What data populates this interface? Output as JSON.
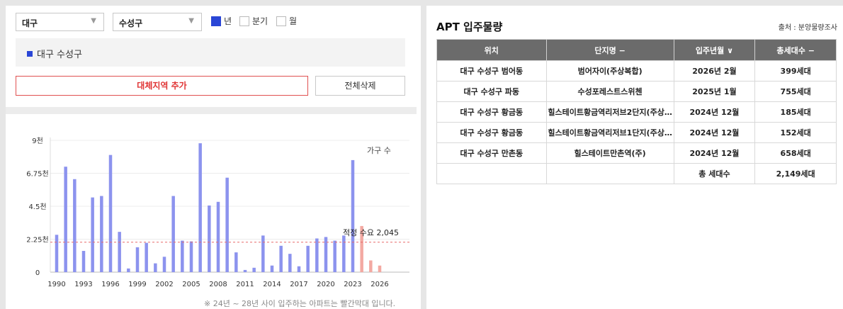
{
  "filters": {
    "region": "대구",
    "district": "수성구",
    "period_options": [
      {
        "label": "년",
        "checked": true
      },
      {
        "label": "분기",
        "checked": false
      },
      {
        "label": "월",
        "checked": false
      }
    ]
  },
  "selected_regions": [
    "대구 수성구"
  ],
  "buttons": {
    "add_region": "대체지역 추가",
    "clear_all": "전체삭제"
  },
  "colors": {
    "accent": "#2a46d6",
    "bar_past": "#8c93ee",
    "bar_future": "#f3a9a2",
    "threshold": "#e86a6a"
  },
  "chart_data": {
    "type": "bar",
    "unit_label": "가구 수",
    "x": [
      1990,
      1991,
      1992,
      1993,
      1994,
      1995,
      1996,
      1997,
      1998,
      1999,
      2000,
      2001,
      2002,
      2003,
      2004,
      2005,
      2006,
      2007,
      2008,
      2009,
      2010,
      2011,
      2012,
      2013,
      2014,
      2015,
      2016,
      2017,
      2018,
      2019,
      2020,
      2021,
      2022,
      2023,
      2024,
      2025,
      2026
    ],
    "values": [
      2550,
      7200,
      6350,
      1450,
      5100,
      5200,
      8000,
      2750,
      250,
      1700,
      2000,
      600,
      1050,
      5200,
      2150,
      2100,
      8800,
      4550,
      4800,
      6450,
      1350,
      150,
      300,
      2500,
      450,
      1800,
      1250,
      400,
      1800,
      2300,
      2400,
      2150,
      2500,
      7650,
      3150,
      800,
      450
    ],
    "future_from": 2024,
    "x_ticks": [
      "1990",
      "1993",
      "1996",
      "1999",
      "2002",
      "2005",
      "2008",
      "2011",
      "2014",
      "2017",
      "2020",
      "2023",
      "2026"
    ],
    "y_ticks": [
      "0",
      "2.25천",
      "4.5천",
      "6.75천",
      "9천"
    ],
    "ylim": [
      0,
      9000
    ],
    "threshold": {
      "label": "적정 수요 2,045",
      "value": 2045
    },
    "footnote": "※ 24년 ~ 28년 사이 입주하는 아파트는 빨간막대 입니다."
  },
  "apt": {
    "title": "APT 입주물량",
    "source": "출처 : 분양물량조사",
    "headers": [
      "위치",
      "단지명 −",
      "입주년월 ∨",
      "총세대수 −"
    ],
    "rows": [
      [
        "대구 수성구 범어동",
        "범어자이(주상복합)",
        "2026년 2월",
        "399세대"
      ],
      [
        "대구 수성구 파동",
        "수성포레스트스위첸",
        "2025년 1월",
        "755세대"
      ],
      [
        "대구 수성구 황금동",
        "힐스테이트황금역리저브2단지(주상…",
        "2024년 12월",
        "185세대"
      ],
      [
        "대구 수성구 황금동",
        "힐스테이트황금역리저브1단지(주상…",
        "2024년 12월",
        "152세대"
      ],
      [
        "대구 수성구 만촌동",
        "힐스테이트만촌역(주)",
        "2024년 12월",
        "658세대"
      ]
    ],
    "total_label": "총 세대수",
    "total_value": "2,149세대"
  }
}
